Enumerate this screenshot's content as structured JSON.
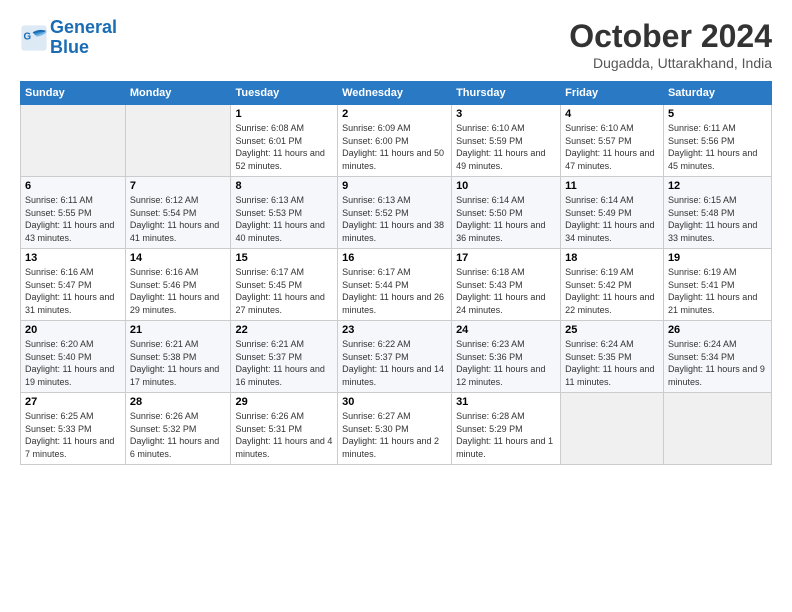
{
  "logo": {
    "line1": "General",
    "line2": "Blue"
  },
  "title": "October 2024",
  "location": "Dugadda, Uttarakhand, India",
  "days_header": [
    "Sunday",
    "Monday",
    "Tuesday",
    "Wednesday",
    "Thursday",
    "Friday",
    "Saturday"
  ],
  "weeks": [
    [
      {
        "day": "",
        "empty": true
      },
      {
        "day": "",
        "empty": true
      },
      {
        "day": "1",
        "sunrise": "6:08 AM",
        "sunset": "6:01 PM",
        "daylight": "11 hours and 52 minutes."
      },
      {
        "day": "2",
        "sunrise": "6:09 AM",
        "sunset": "6:00 PM",
        "daylight": "11 hours and 50 minutes."
      },
      {
        "day": "3",
        "sunrise": "6:10 AM",
        "sunset": "5:59 PM",
        "daylight": "11 hours and 49 minutes."
      },
      {
        "day": "4",
        "sunrise": "6:10 AM",
        "sunset": "5:57 PM",
        "daylight": "11 hours and 47 minutes."
      },
      {
        "day": "5",
        "sunrise": "6:11 AM",
        "sunset": "5:56 PM",
        "daylight": "11 hours and 45 minutes."
      }
    ],
    [
      {
        "day": "6",
        "sunrise": "6:11 AM",
        "sunset": "5:55 PM",
        "daylight": "11 hours and 43 minutes."
      },
      {
        "day": "7",
        "sunrise": "6:12 AM",
        "sunset": "5:54 PM",
        "daylight": "11 hours and 41 minutes."
      },
      {
        "day": "8",
        "sunrise": "6:13 AM",
        "sunset": "5:53 PM",
        "daylight": "11 hours and 40 minutes."
      },
      {
        "day": "9",
        "sunrise": "6:13 AM",
        "sunset": "5:52 PM",
        "daylight": "11 hours and 38 minutes."
      },
      {
        "day": "10",
        "sunrise": "6:14 AM",
        "sunset": "5:50 PM",
        "daylight": "11 hours and 36 minutes."
      },
      {
        "day": "11",
        "sunrise": "6:14 AM",
        "sunset": "5:49 PM",
        "daylight": "11 hours and 34 minutes."
      },
      {
        "day": "12",
        "sunrise": "6:15 AM",
        "sunset": "5:48 PM",
        "daylight": "11 hours and 33 minutes."
      }
    ],
    [
      {
        "day": "13",
        "sunrise": "6:16 AM",
        "sunset": "5:47 PM",
        "daylight": "11 hours and 31 minutes."
      },
      {
        "day": "14",
        "sunrise": "6:16 AM",
        "sunset": "5:46 PM",
        "daylight": "11 hours and 29 minutes."
      },
      {
        "day": "15",
        "sunrise": "6:17 AM",
        "sunset": "5:45 PM",
        "daylight": "11 hours and 27 minutes."
      },
      {
        "day": "16",
        "sunrise": "6:17 AM",
        "sunset": "5:44 PM",
        "daylight": "11 hours and 26 minutes."
      },
      {
        "day": "17",
        "sunrise": "6:18 AM",
        "sunset": "5:43 PM",
        "daylight": "11 hours and 24 minutes."
      },
      {
        "day": "18",
        "sunrise": "6:19 AM",
        "sunset": "5:42 PM",
        "daylight": "11 hours and 22 minutes."
      },
      {
        "day": "19",
        "sunrise": "6:19 AM",
        "sunset": "5:41 PM",
        "daylight": "11 hours and 21 minutes."
      }
    ],
    [
      {
        "day": "20",
        "sunrise": "6:20 AM",
        "sunset": "5:40 PM",
        "daylight": "11 hours and 19 minutes."
      },
      {
        "day": "21",
        "sunrise": "6:21 AM",
        "sunset": "5:38 PM",
        "daylight": "11 hours and 17 minutes."
      },
      {
        "day": "22",
        "sunrise": "6:21 AM",
        "sunset": "5:37 PM",
        "daylight": "11 hours and 16 minutes."
      },
      {
        "day": "23",
        "sunrise": "6:22 AM",
        "sunset": "5:37 PM",
        "daylight": "11 hours and 14 minutes."
      },
      {
        "day": "24",
        "sunrise": "6:23 AM",
        "sunset": "5:36 PM",
        "daylight": "11 hours and 12 minutes."
      },
      {
        "day": "25",
        "sunrise": "6:24 AM",
        "sunset": "5:35 PM",
        "daylight": "11 hours and 11 minutes."
      },
      {
        "day": "26",
        "sunrise": "6:24 AM",
        "sunset": "5:34 PM",
        "daylight": "11 hours and 9 minutes."
      }
    ],
    [
      {
        "day": "27",
        "sunrise": "6:25 AM",
        "sunset": "5:33 PM",
        "daylight": "11 hours and 7 minutes."
      },
      {
        "day": "28",
        "sunrise": "6:26 AM",
        "sunset": "5:32 PM",
        "daylight": "11 hours and 6 minutes."
      },
      {
        "day": "29",
        "sunrise": "6:26 AM",
        "sunset": "5:31 PM",
        "daylight": "11 hours and 4 minutes."
      },
      {
        "day": "30",
        "sunrise": "6:27 AM",
        "sunset": "5:30 PM",
        "daylight": "11 hours and 2 minutes."
      },
      {
        "day": "31",
        "sunrise": "6:28 AM",
        "sunset": "5:29 PM",
        "daylight": "11 hours and 1 minute."
      },
      {
        "day": "",
        "empty": true
      },
      {
        "day": "",
        "empty": true
      }
    ]
  ]
}
